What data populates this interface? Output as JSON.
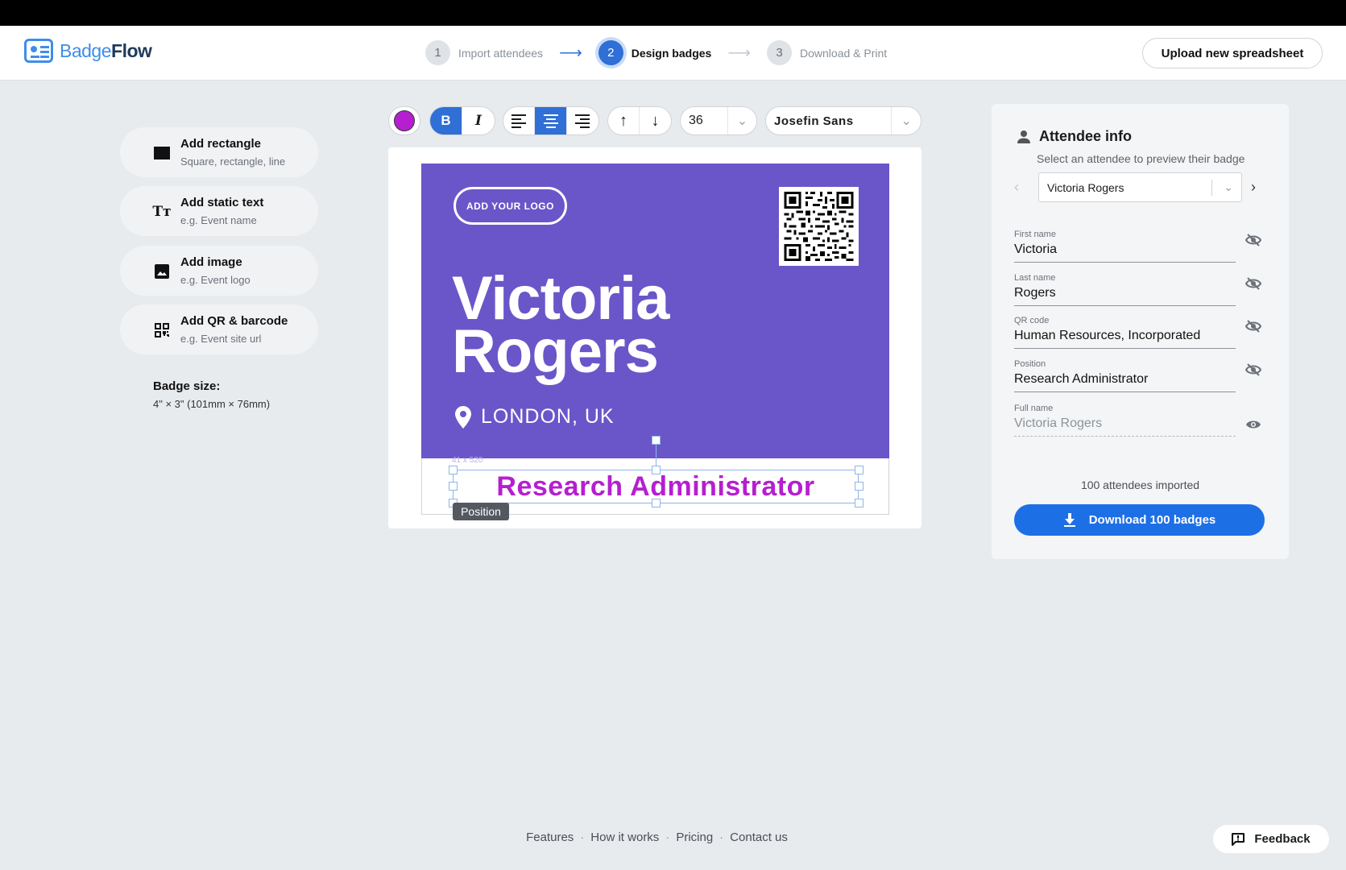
{
  "app": {
    "name_part1": "Badge",
    "name_part2": "Flow"
  },
  "steps": [
    {
      "num": "1",
      "label": "Import attendees"
    },
    {
      "num": "2",
      "label": "Design badges"
    },
    {
      "num": "3",
      "label": "Download & Print"
    }
  ],
  "header": {
    "upload_label": "Upload new spreadsheet"
  },
  "tools": [
    {
      "title": "Add rectangle",
      "subtitle": "Square, rectangle, line",
      "icon": "rectangle-icon"
    },
    {
      "title": "Add static text",
      "subtitle": "e.g. Event name",
      "icon": "text-icon"
    },
    {
      "title": "Add image",
      "subtitle": "e.g. Event logo",
      "icon": "image-icon"
    },
    {
      "title": "Add QR & barcode",
      "subtitle": "e.g. Event site url",
      "icon": "qr-icon"
    }
  ],
  "badge_size": {
    "label": "Badge size:",
    "value": "4\" × 3\" (101mm × 76mm)"
  },
  "toolbar": {
    "color": "#b51fd0",
    "bold": "B",
    "italic": "I",
    "font_size": "36",
    "font_family": "Josefin Sans"
  },
  "badge": {
    "logo_placeholder": "ADD YOUR LOGO",
    "first_name": "Victoria",
    "last_name": "Rogers",
    "location": "LONDON, UK",
    "position": "Research Administrator",
    "position_tag": "Position",
    "dims": "41 x 520",
    "bg_color": "#6a56c9"
  },
  "panel": {
    "title": "Attendee info",
    "subtitle": "Select an attendee to preview their badge",
    "selected_attendee": "Victoria Rogers",
    "fields": [
      {
        "label": "First name",
        "value": "Victoria"
      },
      {
        "label": "Last name",
        "value": "Rogers"
      },
      {
        "label": "QR code",
        "value": "Human Resources, Incorporated"
      },
      {
        "label": "Position",
        "value": "Research Administrator"
      },
      {
        "label": "Full name",
        "value": "Victoria Rogers"
      }
    ],
    "imported": "100 attendees imported",
    "download_label": "Download 100 badges"
  },
  "footer": {
    "links": [
      "Features",
      "How it works",
      "Pricing",
      "Contact us"
    ],
    "feedback": "Feedback"
  }
}
